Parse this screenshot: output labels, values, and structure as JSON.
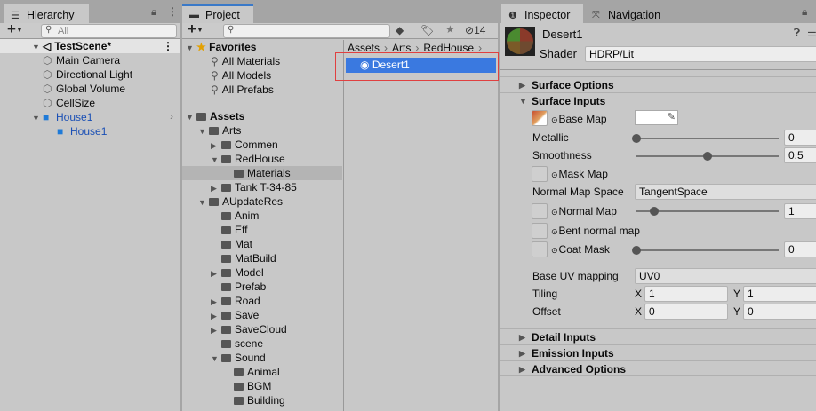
{
  "hierarchy": {
    "tab": "Hierarchy",
    "search_placeholder": "All",
    "scene": "TestScene*",
    "items": [
      {
        "label": "Main Camera",
        "depth": 1
      },
      {
        "label": "Directional Light",
        "depth": 1
      },
      {
        "label": "Global Volume",
        "depth": 1
      },
      {
        "label": "CellSize",
        "depth": 1
      },
      {
        "label": "House1",
        "depth": 1,
        "prefab": true,
        "expanded": true
      },
      {
        "label": "House1",
        "depth": 2,
        "prefab": true
      }
    ]
  },
  "project": {
    "tab": "Project",
    "hidden_count": "14",
    "breadcrumb": [
      "Assets",
      "Arts",
      "RedHouse"
    ],
    "files": [
      {
        "label": "Desert1",
        "selected": true
      }
    ],
    "favorites": {
      "label": "Favorites",
      "items": [
        "All Materials",
        "All Models",
        "All Prefabs"
      ]
    },
    "tree": [
      {
        "label": "Assets",
        "depth": 0,
        "exp": true,
        "bold": true
      },
      {
        "label": "Arts",
        "depth": 1,
        "exp": true
      },
      {
        "label": "Commen",
        "depth": 2,
        "exp": false
      },
      {
        "label": "RedHouse",
        "depth": 2,
        "exp": true
      },
      {
        "label": "Materials",
        "depth": 3,
        "selected": true
      },
      {
        "label": "Tank T-34-85",
        "depth": 2,
        "exp": false
      },
      {
        "label": "AUpdateRes",
        "depth": 1,
        "exp": true
      },
      {
        "label": "Anim",
        "depth": 2
      },
      {
        "label": "Eff",
        "depth": 2
      },
      {
        "label": "Mat",
        "depth": 2
      },
      {
        "label": "MatBuild",
        "depth": 2
      },
      {
        "label": "Model",
        "depth": 2,
        "exp": false
      },
      {
        "label": "Prefab",
        "depth": 2
      },
      {
        "label": "Road",
        "depth": 2,
        "exp": false
      },
      {
        "label": "Save",
        "depth": 2,
        "exp": false
      },
      {
        "label": "SaveCloud",
        "depth": 2,
        "exp": false
      },
      {
        "label": "scene",
        "depth": 2
      },
      {
        "label": "Sound",
        "depth": 2,
        "exp": true
      },
      {
        "label": "Animal",
        "depth": 3
      },
      {
        "label": "BGM",
        "depth": 3
      },
      {
        "label": "Building",
        "depth": 3
      }
    ]
  },
  "inspector": {
    "tabs": [
      "Inspector",
      "Navigation"
    ],
    "material": "Desert1",
    "shader_label": "Shader",
    "shader": "HDRP/Lit",
    "sections": {
      "surface_options": "Surface Options",
      "surface_inputs": "Surface Inputs",
      "detail": "Detail Inputs",
      "emission": "Emission Inputs",
      "advanced": "Advanced Options"
    },
    "base_map": "Base Map",
    "metallic": {
      "label": "Metallic",
      "value": "0",
      "fraction": 0
    },
    "smoothness": {
      "label": "Smoothness",
      "value": "0.5",
      "fraction": 0.5
    },
    "mask_map": "Mask Map",
    "normal_map_space": {
      "label": "Normal Map Space",
      "value": "TangentSpace"
    },
    "normal_map": {
      "label": "Normal Map",
      "value": "1",
      "fraction": 0.125
    },
    "bent_normal": "Bent normal map",
    "coat_mask": {
      "label": "Coat Mask",
      "value": "0",
      "fraction": 0
    },
    "base_uv": {
      "label": "Base UV mapping",
      "value": "UV0"
    },
    "tiling": {
      "label": "Tiling",
      "x": "1",
      "y": "1"
    },
    "offset": {
      "label": "Offset",
      "x": "0",
      "y": "0"
    },
    "x": "X",
    "y": "Y"
  }
}
